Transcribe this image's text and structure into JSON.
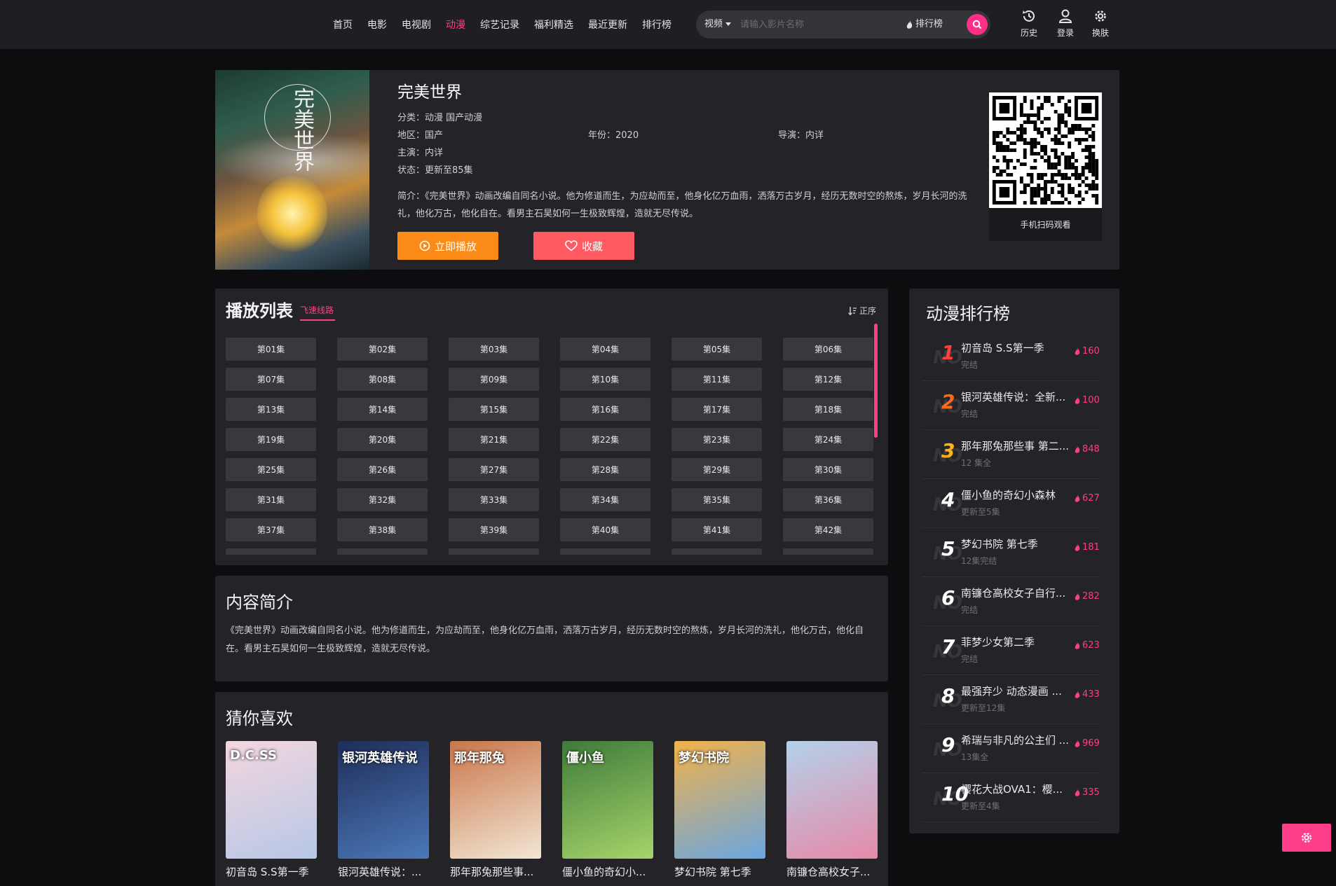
{
  "nav": [
    "首页",
    "电影",
    "电视剧",
    "动漫",
    "综艺记录",
    "福利精选",
    "最近更新",
    "排行榜"
  ],
  "nav_active": 3,
  "search": {
    "type": "视频",
    "placeholder": "请输入影片名称",
    "rank": "排行榜"
  },
  "header_tools": {
    "history": "历史",
    "login": "登录",
    "skin": "换肤"
  },
  "detail": {
    "title": "完美世界",
    "poster_text": "完美世界",
    "category": "分类：动漫  国产动漫",
    "region": "地区：国产",
    "year": "年份：2020",
    "director": "导演：内详",
    "cast": "主演：内详",
    "status": "状态：更新至85集",
    "summary": "简介：《完美世界》动画改编自同名小说。他为修道而生，为应劫而至，他身化亿万血雨，洒落万古岁月，经历无数时空的熬炼，岁月长河的洗礼，他化万古，他化自在。看男主石昊如何一生极致辉煌，造就无尽传说。",
    "play_label": "立即播放",
    "fav_label": "收藏",
    "qr_label": "手机扫码观看"
  },
  "playlist": {
    "title": "播放列表",
    "route": "飞速线路",
    "sort": "正序",
    "episodes": [
      "第01集",
      "第02集",
      "第03集",
      "第04集",
      "第05集",
      "第06集",
      "第07集",
      "第08集",
      "第09集",
      "第10集",
      "第11集",
      "第12集",
      "第13集",
      "第14集",
      "第15集",
      "第16集",
      "第17集",
      "第18集",
      "第19集",
      "第20集",
      "第21集",
      "第22集",
      "第23集",
      "第24集",
      "第25集",
      "第26集",
      "第27集",
      "第28集",
      "第29集",
      "第30集",
      "第31集",
      "第32集",
      "第33集",
      "第34集",
      "第35集",
      "第36集",
      "第37集",
      "第38集",
      "第39集",
      "第40集",
      "第41集",
      "第42集",
      "",
      "",
      "",
      "",
      "",
      ""
    ]
  },
  "intro": {
    "title": "内容简介",
    "text": "《完美世界》动画改编自同名小说。他为修道而生，为应劫而至，他身化亿万血雨，洒落万古岁月，经历无数时空的熬炼，岁月长河的洗礼，他化万古，他化自在。看男主石昊如何一生极致辉煌，造就无尽传说。"
  },
  "recommend": {
    "title": "猜你喜欢",
    "items": [
      {
        "name": "初音岛 S.S第一季",
        "colors": [
          "#f3d7df",
          "#b7c7e6"
        ],
        "thumb": "D.C.SS"
      },
      {
        "name": "银河英雄传说：...",
        "colors": [
          "#1f2d59",
          "#4b78b8"
        ],
        "thumb": "银河英雄传说"
      },
      {
        "name": "那年那兔那些事...",
        "colors": [
          "#c9764a",
          "#f2e6d4"
        ],
        "thumb": "那年那兔"
      },
      {
        "name": "僵小鱼的奇幻小...",
        "colors": [
          "#3e7b3a",
          "#a7d46a"
        ],
        "thumb": "僵小鱼"
      },
      {
        "name": "梦幻书院 第七季",
        "colors": [
          "#f2b24a",
          "#6aa6e0"
        ],
        "thumb": "梦幻书院"
      },
      {
        "name": "南镰仓高校女子...",
        "colors": [
          "#b4d1ea",
          "#e58aa8"
        ],
        "thumb": ""
      }
    ]
  },
  "ranking": {
    "title": "动漫排行榜",
    "items": [
      {
        "rank": "1",
        "name": "初音岛 S.S第一季",
        "status": "完结",
        "hot": "160",
        "color": "#ff3e3e"
      },
      {
        "rank": "2",
        "name": "银河英雄传说：全新...",
        "status": "完结",
        "hot": "100",
        "color": "#ff6a1a"
      },
      {
        "rank": "3",
        "name": "那年那兔那些事 第二...",
        "status": "12 集全",
        "hot": "848",
        "color": "#ffb21a"
      },
      {
        "rank": "4",
        "name": "僵小鱼的奇幻小森林",
        "status": "更新至5集",
        "hot": "627",
        "color": "#ffffff"
      },
      {
        "rank": "5",
        "name": "梦幻书院 第七季",
        "status": "12集完结",
        "hot": "181",
        "color": "#ffffff"
      },
      {
        "rank": "6",
        "name": "南镰仓高校女子自行...",
        "status": "完结",
        "hot": "282",
        "color": "#ffffff"
      },
      {
        "rank": "7",
        "name": "菲梦少女第二季",
        "status": "完结",
        "hot": "623",
        "color": "#ffffff"
      },
      {
        "rank": "8",
        "name": "最强弃少 动态漫画 ...",
        "status": "更新至12集",
        "hot": "433",
        "color": "#ffffff"
      },
      {
        "rank": "9",
        "name": "希瑞与非凡的公主们 ...",
        "status": "13集全",
        "hot": "969",
        "color": "#ffffff"
      },
      {
        "rank": "10",
        "name": "樱花大战OVA1：樱...",
        "status": "更新至4集",
        "hot": "335",
        "color": "#ffffff"
      }
    ]
  },
  "colors": {
    "accent": "#ff3e8a",
    "play": "#fb8a16",
    "fav": "#ff5a61",
    "panel": "#232328",
    "bg": "#0d0d0f"
  }
}
